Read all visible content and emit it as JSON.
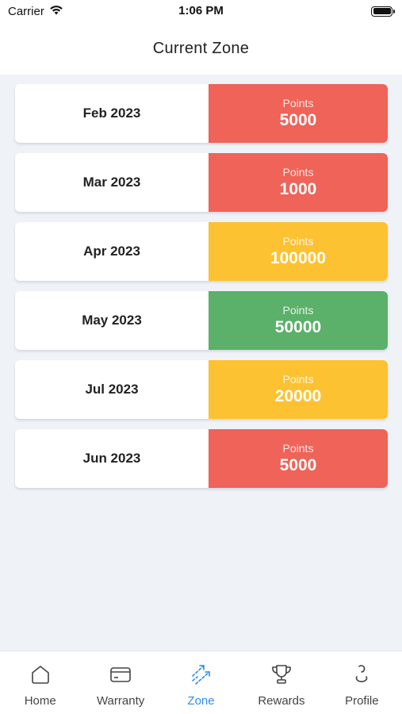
{
  "status_bar": {
    "carrier": "Carrier",
    "time": "1:06 PM"
  },
  "header": {
    "title": "Current Zone"
  },
  "colors": {
    "red": "#ef6358",
    "yellow": "#fdc232",
    "green": "#5bb06a",
    "active_tab": "#2f8cf0"
  },
  "zones": [
    {
      "month": "Feb 2023",
      "points_label": "Points",
      "points": "5000",
      "color": "#ef6358"
    },
    {
      "month": "Mar 2023",
      "points_label": "Points",
      "points": "1000",
      "color": "#ef6358"
    },
    {
      "month": "Apr 2023",
      "points_label": "Points",
      "points": "100000",
      "color": "#fdc232"
    },
    {
      "month": "May 2023",
      "points_label": "Points",
      "points": "50000",
      "color": "#5bb06a"
    },
    {
      "month": "Jul 2023",
      "points_label": "Points",
      "points": "20000",
      "color": "#fdc232"
    },
    {
      "month": "Jun 2023",
      "points_label": "Points",
      "points": "5000",
      "color": "#ef6358"
    }
  ],
  "tabs": [
    {
      "label": "Home",
      "icon": "home-icon",
      "active": false
    },
    {
      "label": "Warranty",
      "icon": "card-icon",
      "active": false
    },
    {
      "label": "Zone",
      "icon": "trend-arrows-icon",
      "active": true
    },
    {
      "label": "Rewards",
      "icon": "trophy-icon",
      "active": false
    },
    {
      "label": "Profile",
      "icon": "profile-icon",
      "active": false
    }
  ]
}
